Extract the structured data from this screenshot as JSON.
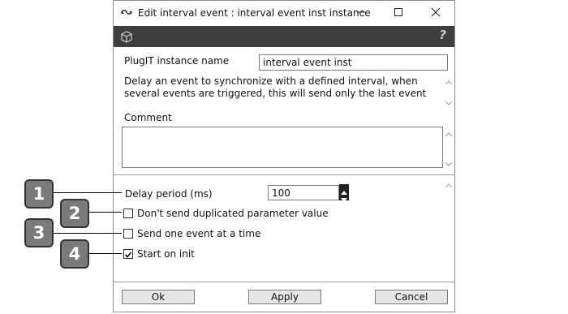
{
  "window": {
    "title": "Edit interval event : interval event inst instance"
  },
  "title_controls": {
    "minimize_icon": "minimize-icon",
    "maximize_icon": "maximize-icon",
    "close_icon": "close-icon"
  },
  "toolbar": {
    "left_icon": "cube-icon",
    "help_glyph": "?"
  },
  "form": {
    "instance_name_label": "PlugIT instance name",
    "instance_name_value": "interval event inst",
    "description": "Delay an event to synchronize with a defined interval, when several events are triggered, this will send only the last event",
    "comment_label": "Comment",
    "comment_value": ""
  },
  "params": {
    "delay_label": "Delay period (ms)",
    "delay_value": "100",
    "options": [
      {
        "label": "Don't send duplicated parameter value",
        "checked": false
      },
      {
        "label": "Send one event at a time",
        "checked": false
      },
      {
        "label": "Start on init",
        "checked": true
      }
    ]
  },
  "buttons": {
    "ok": "Ok",
    "apply": "Apply",
    "cancel": "Cancel"
  },
  "callouts": [
    "1",
    "2",
    "3",
    "4"
  ],
  "colors": {
    "toolbar_bg": "#3e3e3e",
    "callout_bg": "#7a7a7a",
    "button_bg": "#e6e6e6"
  }
}
